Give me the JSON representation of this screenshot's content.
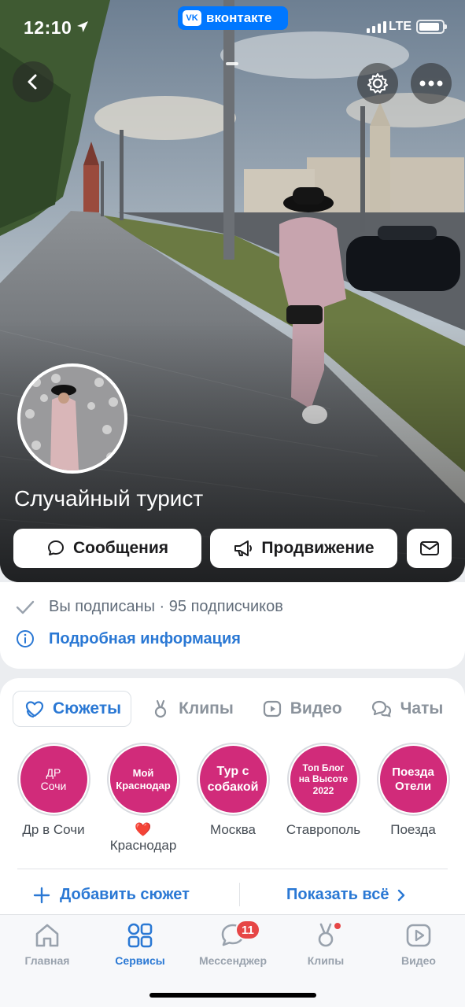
{
  "status_bar": {
    "time": "12:10",
    "app_pill": "вконтакте",
    "app_pill_logo": "VK",
    "network": "LTE"
  },
  "profile": {
    "name": "Случайный турист",
    "subscription_text": "Вы подписаны · 95 подписчиков",
    "more_info_link": "Подробная информация"
  },
  "actions": {
    "messages_label": "Сообщения",
    "promotion_label": "Продвижение"
  },
  "content_tabs": [
    {
      "label": "Сюжеты",
      "icon": "stories-icon",
      "active": true
    },
    {
      "label": "Клипы",
      "icon": "clips-icon",
      "active": false
    },
    {
      "label": "Видео",
      "icon": "video-icon",
      "active": false
    },
    {
      "label": "Чаты",
      "icon": "chats-icon",
      "active": false
    }
  ],
  "stories": [
    {
      "cover": "ДР\nСочи",
      "label": "Др в Сочи",
      "emoji": ""
    },
    {
      "cover": "Мой\nКраснодар",
      "label": "Краснодар",
      "emoji": "❤️"
    },
    {
      "cover": "Тур с\nсобакой",
      "label": "Москва",
      "emoji": ""
    },
    {
      "cover": "Топ Блог\nна Высоте\n2022",
      "label": "Ставрополь",
      "emoji": ""
    },
    {
      "cover": "Поезда\nОтели",
      "label": "Поезда",
      "emoji": ""
    }
  ],
  "story_actions": {
    "add_label": "Добавить сюжет",
    "show_all_label": "Показать всё"
  },
  "bottom_nav": [
    {
      "label": "Главная",
      "icon": "home-icon",
      "active": false
    },
    {
      "label": "Сервисы",
      "icon": "services-icon",
      "active": true
    },
    {
      "label": "Мессенджер",
      "icon": "messenger-icon",
      "active": false,
      "badge": "11"
    },
    {
      "label": "Клипы",
      "icon": "clips-icon",
      "active": false,
      "dot": true
    },
    {
      "label": "Видео",
      "icon": "video-icon",
      "active": false
    }
  ],
  "colors": {
    "accent": "#2a78d4",
    "story_cover": "#d12b7a",
    "badge": "#e64646",
    "vk_blue": "#0077ff"
  }
}
